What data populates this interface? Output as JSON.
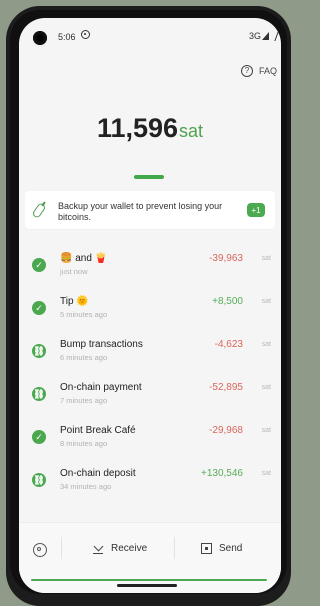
{
  "status_bar": {
    "time": "5:06",
    "network": "3G"
  },
  "header": {
    "faq_label": "FAQ"
  },
  "balance": {
    "value": "11,596",
    "unit": "sat"
  },
  "backup": {
    "text": "Backup your wallet to prevent losing your bitcoins.",
    "badge": "+1"
  },
  "transactions": [
    {
      "title": "🍔 and 🍟",
      "time": "just now",
      "amount": "-39,963",
      "unit": "sat",
      "type": "negative",
      "icon": "check-circle-icon"
    },
    {
      "title": "Tip 🌞",
      "time": "5 minutes ago",
      "amount": "+8,500",
      "unit": "sat",
      "type": "positive",
      "icon": "check-circle-icon"
    },
    {
      "title": "Bump transactions",
      "time": "6 minutes ago",
      "amount": "-4,623",
      "unit": "sat",
      "type": "negative",
      "icon": "link-icon"
    },
    {
      "title": "On-chain payment",
      "time": "7 minutes ago",
      "amount": "-52,895",
      "unit": "sat",
      "type": "negative",
      "icon": "link-icon"
    },
    {
      "title": "Point Break Café",
      "time": "8 minutes ago",
      "amount": "-29,968",
      "unit": "sat",
      "type": "negative",
      "icon": "check-circle-icon"
    },
    {
      "title": "On-chain deposit",
      "time": "34 minutes ago",
      "amount": "+130,546",
      "unit": "sat",
      "type": "positive",
      "icon": "link-icon"
    }
  ],
  "bottom_nav": {
    "receive_label": "Receive",
    "send_label": "Send"
  },
  "colors": {
    "accent_green": "#4ba84f",
    "negative_red": "#d8665b"
  }
}
